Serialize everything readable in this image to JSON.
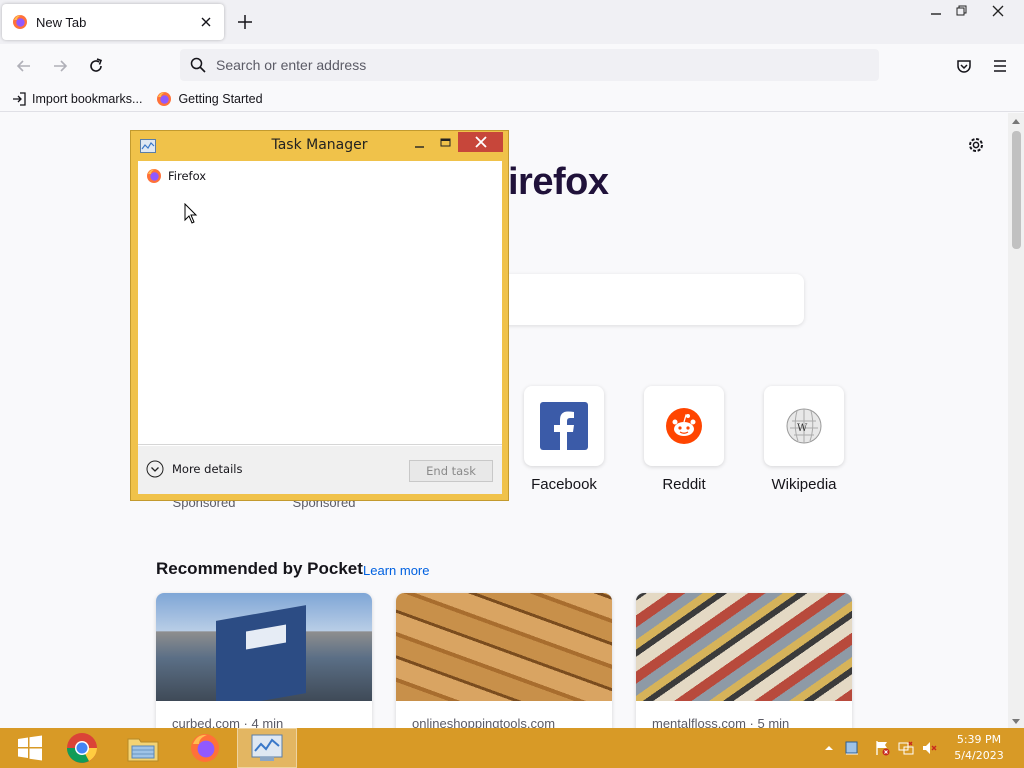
{
  "window": {
    "tab_title": "New Tab",
    "controls": [
      "minimize",
      "restore",
      "close"
    ]
  },
  "navbar": {
    "search_placeholder": "Search or enter address"
  },
  "bookmarks": [
    {
      "label": "Import bookmarks...",
      "icon": "import-icon"
    },
    {
      "label": "Getting Started",
      "icon": "firefox-icon"
    }
  ],
  "newtab": {
    "brand": "irefox",
    "top_sites": [
      {
        "label": "Facebook",
        "icon": "facebook-icon"
      },
      {
        "label": "Reddit",
        "icon": "reddit-icon"
      },
      {
        "label": "Wikipedia",
        "icon": "wikipedia-icon"
      }
    ],
    "sponsored": [
      "Sponsored",
      "Sponsored"
    ],
    "pocket": {
      "title": "Recommended by Pocket",
      "learn_more": "Learn more",
      "cards": [
        {
          "source": "curbed.com · 4 min"
        },
        {
          "source": "onlineshoppingtools.com"
        },
        {
          "source": "mentalfloss.com · 5 min"
        }
      ]
    }
  },
  "task_manager": {
    "title": "Task Manager",
    "processes": [
      {
        "name": "Firefox",
        "icon": "firefox-icon"
      }
    ],
    "more_details": "More details",
    "end_task": "End task"
  },
  "taskbar": {
    "apps": [
      "start",
      "chrome",
      "file-explorer",
      "firefox",
      "task-manager"
    ],
    "active_app": "task-manager",
    "time": "5:39 PM",
    "date": "5/4/2023"
  },
  "colors": {
    "taskbar": "#d89a26",
    "window_frame": "#f0c24a",
    "close_button": "#c7463a",
    "link": "#0061e0"
  }
}
